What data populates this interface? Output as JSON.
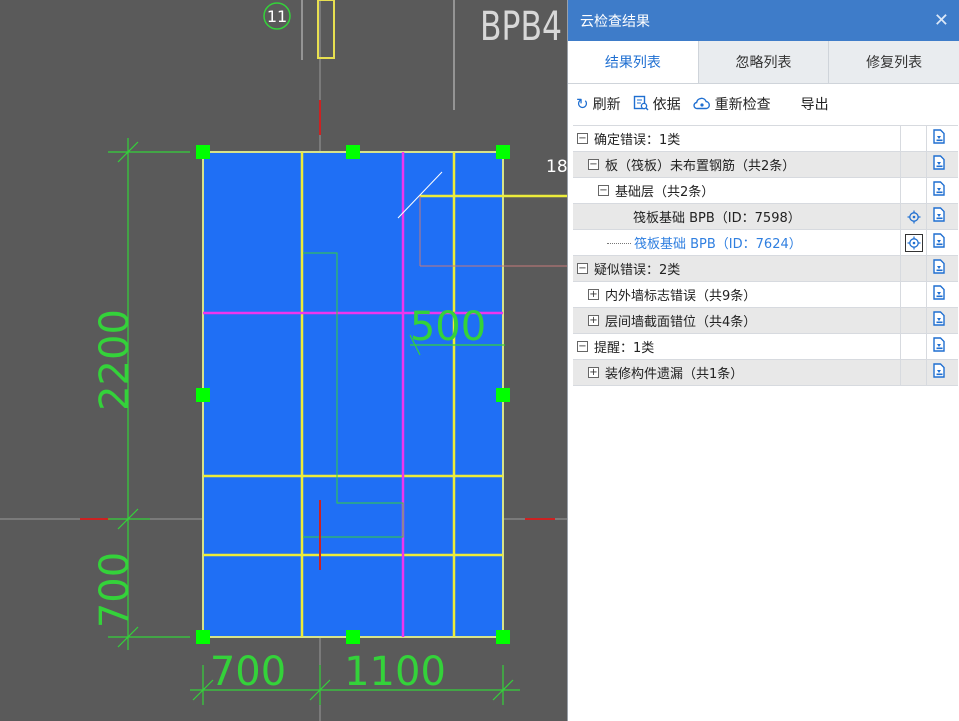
{
  "canvas": {
    "axis_label": "11",
    "element_label": "BPB4",
    "side_label": "18",
    "dims": {
      "height_top": "2200",
      "height_bottom": "700",
      "width_left": "700",
      "width_right": "1100",
      "inner": "500"
    }
  },
  "panel": {
    "title": "云检查结果",
    "close_icon": "close-icon",
    "tabs": [
      "结果列表",
      "忽略列表",
      "修复列表"
    ],
    "active_tab": 0,
    "toolbar": {
      "refresh": "刷新",
      "basis": "依据",
      "recheck": "重新检查",
      "export": "导出"
    },
    "rows": [
      {
        "text": "确定错误：1类",
        "toggle": "−",
        "level": 0,
        "shaded": false
      },
      {
        "text": "板（筏板）未布置钢筋（共2条）",
        "toggle": "−",
        "level": 1,
        "shaded": true
      },
      {
        "text": "基础层（共2条）",
        "toggle": "−",
        "level": 2,
        "shaded": false
      },
      {
        "text": "筏板基础 BPB（ID：7598）",
        "toggle": "",
        "level": 3,
        "shaded": true
      },
      {
        "text": "筏板基础 BPB（ID：7624）",
        "toggle": "",
        "level": 3,
        "shaded": false,
        "selected": true
      },
      {
        "text": "疑似错误：2类",
        "toggle": "−",
        "level": 0,
        "shaded": true
      },
      {
        "text": "内外墙标志错误（共9条）",
        "toggle": "+",
        "level": 1,
        "shaded": false
      },
      {
        "text": "层间墙截面错位（共4条）",
        "toggle": "+",
        "level": 1,
        "shaded": true
      },
      {
        "text": "提醒：1类",
        "toggle": "−",
        "level": 0,
        "shaded": false
      },
      {
        "text": "装修构件遗漏（共1条）",
        "toggle": "+",
        "level": 1,
        "shaded": true
      }
    ],
    "colors": {
      "title_bar": "#3e7cc9",
      "accent": "#1f6fd1",
      "slab_fill": "#1f6ff5",
      "grip": "#00ff00",
      "dim_line": "#34d23a"
    }
  }
}
